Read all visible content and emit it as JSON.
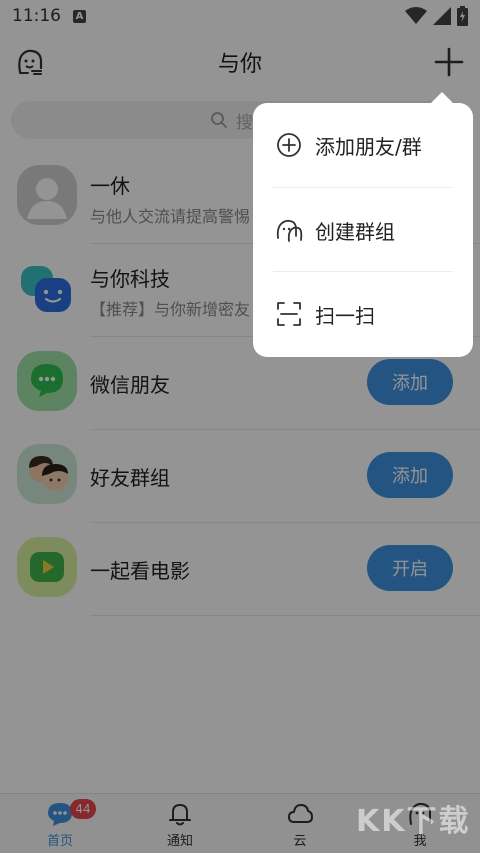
{
  "status_bar": {
    "time": "11:16",
    "notif_badge": "A"
  },
  "header": {
    "title": "与你"
  },
  "search": {
    "placeholder": "搜索"
  },
  "list": [
    {
      "name": "一休",
      "desc": "与他人交流请提高警惕"
    },
    {
      "name": "与你科技",
      "desc": "【推荐】与你新增密友"
    },
    {
      "name": "微信朋友",
      "button": "添加"
    },
    {
      "name": "好友群组",
      "button": "添加"
    },
    {
      "name": "一起看电影",
      "button": "开启"
    }
  ],
  "popup": {
    "items": [
      {
        "label": "添加朋友/群",
        "icon": "add-circle-icon"
      },
      {
        "label": "创建群组",
        "icon": "group-icon"
      },
      {
        "label": "扫一扫",
        "icon": "scan-icon"
      }
    ]
  },
  "tabs": [
    {
      "label": "首页",
      "icon": "chat-bubble-icon",
      "badge": "44",
      "active": true
    },
    {
      "label": "通知",
      "icon": "bell-icon"
    },
    {
      "label": "云",
      "icon": "cloud-icon"
    },
    {
      "label": "我",
      "icon": "profile-icon"
    }
  ],
  "watermark": "KK下载",
  "colors": {
    "accent": "#3f93e0",
    "badge": "#e7454c",
    "overlay": "rgba(0,0,0,0.42)"
  }
}
